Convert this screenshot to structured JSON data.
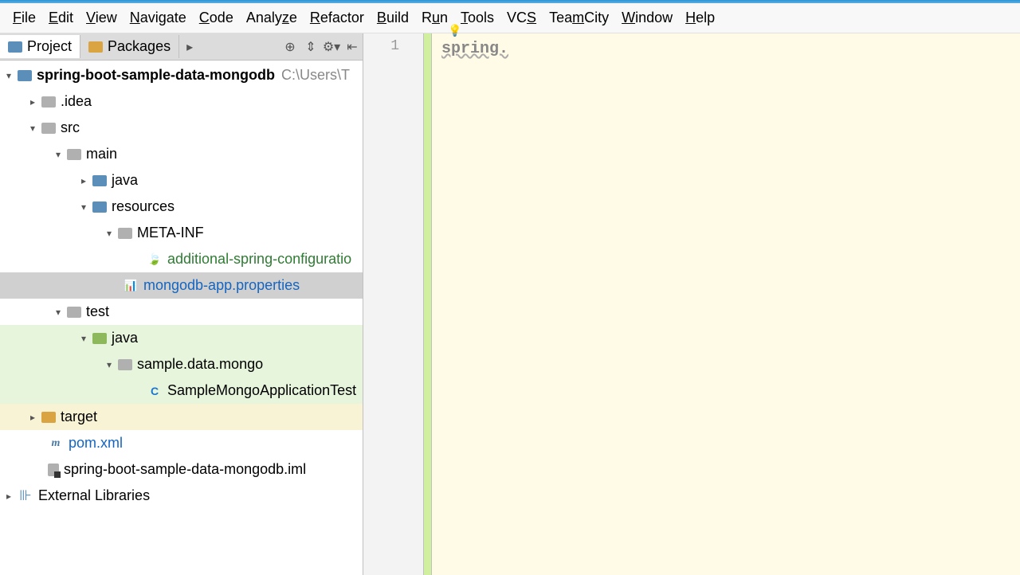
{
  "menu": [
    "File",
    "Edit",
    "View",
    "Navigate",
    "Code",
    "Analyze",
    "Refactor",
    "Build",
    "Run",
    "Tools",
    "VCS",
    "TeamCity",
    "Window",
    "Help"
  ],
  "menu_underline": [
    0,
    0,
    0,
    0,
    0,
    5,
    0,
    0,
    1,
    0,
    2,
    3,
    0,
    0
  ],
  "tabs": {
    "project": "Project",
    "packages": "Packages"
  },
  "tree": {
    "root": {
      "name": "spring-boot-sample-data-mongodb",
      "path": "C:\\Users\\T"
    },
    "idea": ".idea",
    "src": "src",
    "main": "main",
    "java_main": "java",
    "resources": "resources",
    "metainf": "META-INF",
    "addspring": "additional-spring-configuratio",
    "mongoprops": "mongodb-app.properties",
    "test": "test",
    "java_test": "java",
    "sample_pkg": "sample.data.mongo",
    "test_class": "SampleMongoApplicationTest",
    "target": "target",
    "pom": "pom.xml",
    "iml": "spring-boot-sample-data-mongodb.iml",
    "external": "External Libraries"
  },
  "editor": {
    "line_no": "1",
    "content": "spring."
  }
}
